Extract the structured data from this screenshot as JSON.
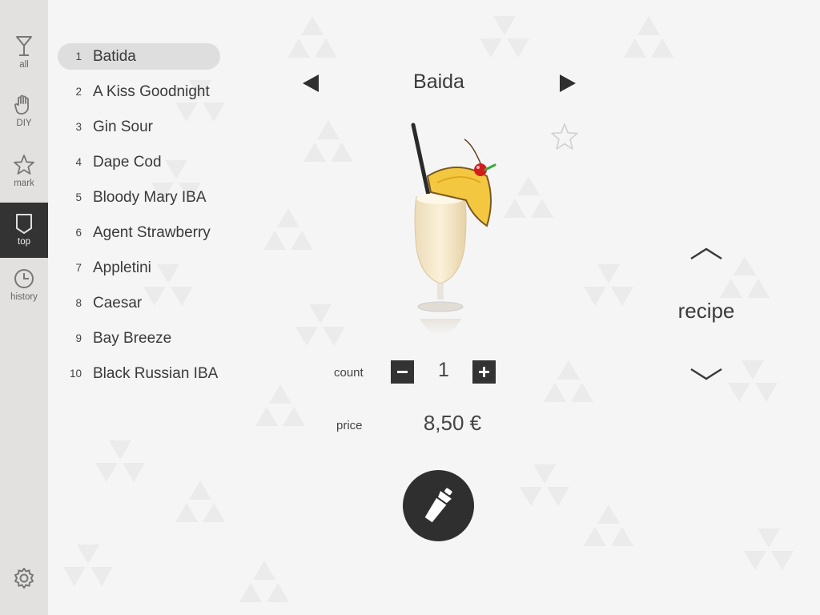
{
  "sidebar": {
    "items": [
      {
        "label": "all",
        "icon": "cocktail-glass-icon",
        "active": false
      },
      {
        "label": "DIY",
        "icon": "hand-icon",
        "active": false
      },
      {
        "label": "mark",
        "icon": "star-icon",
        "active": false
      },
      {
        "label": "top",
        "icon": "badge-icon",
        "active": true
      },
      {
        "label": "history",
        "icon": "clock-icon",
        "active": false
      }
    ],
    "settings_icon": "gear-icon"
  },
  "list": {
    "items": [
      {
        "num": "1",
        "name": "Batida",
        "selected": true
      },
      {
        "num": "2",
        "name": "A Kiss Goodnight"
      },
      {
        "num": "3",
        "name": "Gin Sour"
      },
      {
        "num": "4",
        "name": "Dape Cod"
      },
      {
        "num": "5",
        "name": "Bloody Mary  IBA"
      },
      {
        "num": "6",
        "name": "Agent Strawberry"
      },
      {
        "num": "7",
        "name": "Appletini"
      },
      {
        "num": "8",
        "name": "Caesar"
      },
      {
        "num": "9",
        "name": "Bay Breeze"
      },
      {
        "num": "10",
        "name": "Black Russian  IBA"
      }
    ]
  },
  "detail": {
    "title": "Baida",
    "count_label": "count",
    "count_value": "1",
    "price_label": "price",
    "price_value": "8,50 €",
    "recipe_label": "recipe"
  },
  "colors": {
    "sidebar_bg": "#e2e1df",
    "active_bg": "#333333",
    "background": "#f5f5f5",
    "accent_dark": "#2f2f2f"
  }
}
